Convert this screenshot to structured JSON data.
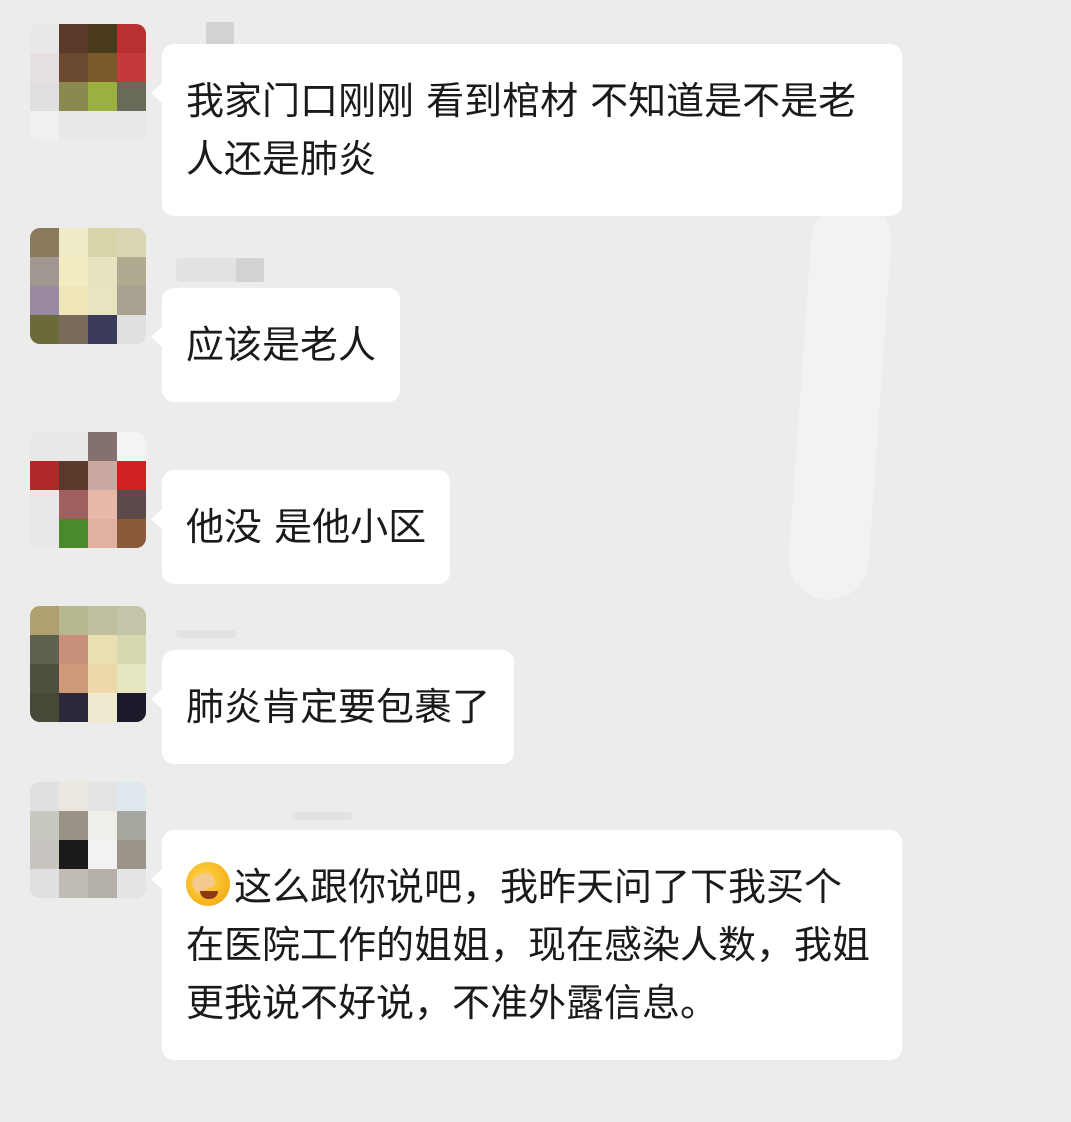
{
  "messages": [
    {
      "text": "我家门口刚刚 看到棺材  不知道是不是老人还是肺炎",
      "avatar_colors": [
        "#e8e8e8",
        "#5a3a2a",
        "#4a3a1a",
        "#b83030",
        "#e6e0e0",
        "#6a4a30",
        "#7a5a2a",
        "#c43a3a",
        "#e0dede",
        "#8a8a50",
        "#9ab040",
        "#6a6a5a",
        "#f0f0f0",
        "#e8e8e8",
        "#e8e8e8",
        "#e8e8e8"
      ]
    },
    {
      "text": "应该是老人",
      "avatar_colors": [
        "#8a7a5a",
        "#f0ecc8",
        "#d6d4a8",
        "#d8d6b0",
        "#a09890",
        "#f2ecc0",
        "#e6e4c0",
        "#b0aa90",
        "#9a8aa0",
        "#eee6b8",
        "#e8e4c2",
        "#a8a090",
        "#6a6a3a",
        "#7a6a5a",
        "#3a3a5a",
        "#e0e0e0"
      ]
    },
    {
      "text": "他没  是他小区",
      "avatar_colors": [
        "#e8e8e8",
        "#e8e8e8",
        "#857070",
        "#f4f4f4",
        "#b02828",
        "#5a3a2a",
        "#c8a8a0",
        "#d02020",
        "#e8e8e8",
        "#a06060",
        "#e8b8a8",
        "#5a4a4a",
        "#e8e8e8",
        "#4a8a2a",
        "#e0b0a0",
        "#8a5a3a"
      ]
    },
    {
      "text": "肺炎肯定要包裹了",
      "avatar_colors": [
        "#b0a070",
        "#b8b890",
        "#c0c0a0",
        "#c4c4a8",
        "#606050",
        "#c89078",
        "#e8e0b0",
        "#d8d8b0",
        "#505040",
        "#d09a7a",
        "#ecd8a8",
        "#e6e6c0",
        "#484838",
        "#2a2a3a",
        "#f0ead0",
        "#1a1a2a"
      ]
    },
    {
      "text": "这么跟你说吧，我昨天问了下我买个在医院工作的姐姐，现在感染人数，我姐更我说不好说，不准外露信息。",
      "avatar_colors": [
        "#e0e0e0",
        "#ece8e0",
        "#e4e4e4",
        "#dfe8ec",
        "#c8c8c0",
        "#9a9488",
        "#f0eee8",
        "#a8a8a0",
        "#c8c4c0",
        "#1a1a1a",
        "#f2f2f2",
        "#9a948a",
        "#e0e0e0",
        "#c0bcb4",
        "#b4b0a8",
        "#e4e4e4"
      ]
    }
  ],
  "icons": {
    "last_message_emoji": "face-palm-emoji-icon"
  }
}
